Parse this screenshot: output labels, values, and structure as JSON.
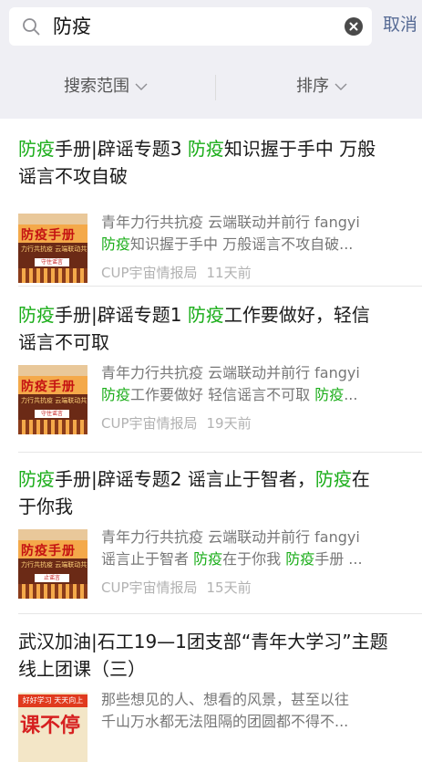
{
  "search": {
    "query": "防疫",
    "cancel_label": "取消"
  },
  "filters": {
    "scope_label": "搜索范围",
    "sort_label": "排序"
  },
  "results": [
    {
      "title_parts": [
        "防疫",
        "手册|辟谣专题3 ",
        "防疫",
        "知识握于手中 万般"
      ],
      "title_line2": "谣言不攻自破",
      "desc_line1": "青年力行共抗疫 云端联动并前行 fangyi",
      "desc_line2_parts": [
        "防疫",
        "知识握于手中 万般谣言不攻自破..."
      ],
      "source": "CUP宇宙情报局",
      "time": "11天前",
      "thumb_title": "防疫手册",
      "thumb_sub": "力行共抗疫 云端联动共前",
      "thumb_tag": "守住谣言"
    },
    {
      "title_parts": [
        "防疫",
        "手册|辟谣专题1 ",
        "防疫",
        "工作要做好，轻信"
      ],
      "title_line2": "谣言不可取",
      "desc_line1": "青年力行共抗疫 云端联动并前行 fangyi",
      "desc_line2_parts": [
        "防疫",
        "工作要做好 轻信谣言不可取 ",
        "防疫",
        "..."
      ],
      "source": "CUP宇宙情报局",
      "time": "19天前",
      "thumb_title": "防疫手册",
      "thumb_sub": "力行共抗疫 云端联动共前",
      "thumb_tag": "守住谣言"
    },
    {
      "title_parts": [
        "防疫",
        "手册|辟谣专题2 谣言止于智者，",
        "防疫",
        "在"
      ],
      "title_line2": "于你我",
      "desc_line1": "青年力行共抗疫 云端联动并前行 fangyi",
      "desc_line2_parts": [
        "谣言止于智者 ",
        "防疫",
        "在于你我 ",
        "防疫",
        "手册 ..."
      ],
      "source": "CUP宇宙情报局",
      "time": "15天前",
      "thumb_title": "防疫手册",
      "thumb_sub": "力行共抗疫 云端联动共前",
      "thumb_tag": "止谣言"
    },
    {
      "title_line1": "武汉加油|石工19—1团支部“青年大学习”主题",
      "title_line2": "线上团课（三）",
      "desc_line1": "那些想见的人、想看的风景，甚至以往",
      "desc_line2": "千山万水都无法阻隔的团圆都不得不...",
      "thumb_top": "好好学习 天天向上",
      "thumb_main": "课不停"
    }
  ],
  "colors": {
    "highlight": "#1aad19",
    "link": "#576b95"
  }
}
